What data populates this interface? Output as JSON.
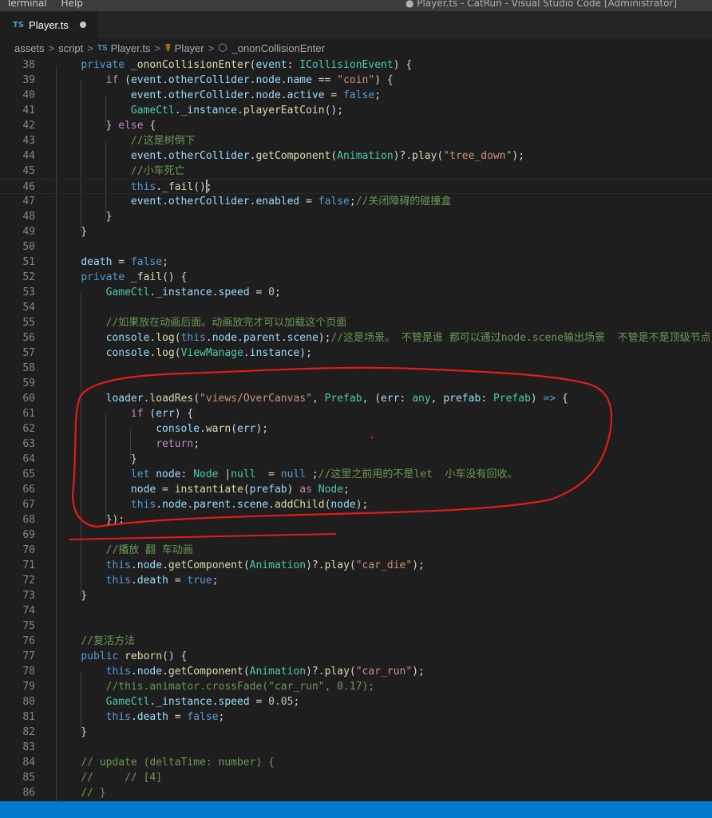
{
  "titlebar": {
    "menu": [
      "Terminal",
      "Help"
    ],
    "window_title": "● Player.ts - CatRun - Visual Studio Code [Administrator]"
  },
  "tab": {
    "badge": "TS",
    "label": "Player.ts"
  },
  "breadcrumb": {
    "items": [
      "assets",
      "script",
      "Player.ts",
      "Player",
      "_ononCollisionEnter"
    ],
    "ts_badge": "TS",
    "class_icon": "class-symbol-icon",
    "method_icon": "method-symbol-icon"
  },
  "colors": {
    "keyword": "#569cd6",
    "control": "#c586c0",
    "function": "#dcdcaa",
    "property": "#9cdcfe",
    "type": "#4ec9b0",
    "string": "#ce9178",
    "number": "#b5cea8",
    "comment": "#6a9955",
    "status_bar": "#007acc",
    "annotation": "#e51b1b"
  },
  "editor": {
    "current_line": 46,
    "lines": [
      {
        "n": "38",
        "t": [
          [
            "    ",
            ""
          ],
          [
            "private",
            "k"
          ],
          [
            " ",
            ""
          ],
          [
            "_ononCollisionEnter",
            "f"
          ],
          [
            "(",
            ""
          ],
          [
            "event",
            "p"
          ],
          [
            ": ",
            ""
          ],
          [
            "ICollisionEvent",
            "t"
          ],
          [
            ") {",
            ""
          ]
        ]
      },
      {
        "n": "39",
        "t": [
          [
            "        ",
            ""
          ],
          [
            "if",
            "c"
          ],
          [
            " (",
            ""
          ],
          [
            "event",
            "p"
          ],
          [
            ".",
            ""
          ],
          [
            "otherCollider",
            "p"
          ],
          [
            ".",
            ""
          ],
          [
            "node",
            "p"
          ],
          [
            ".",
            ""
          ],
          [
            "name",
            "p"
          ],
          [
            " == ",
            ""
          ],
          [
            "\"coin\"",
            "s"
          ],
          [
            ") {",
            ""
          ]
        ]
      },
      {
        "n": "40",
        "t": [
          [
            "            ",
            ""
          ],
          [
            "event",
            "p"
          ],
          [
            ".",
            ""
          ],
          [
            "otherCollider",
            "p"
          ],
          [
            ".",
            ""
          ],
          [
            "node",
            "p"
          ],
          [
            ".",
            ""
          ],
          [
            "active",
            "p"
          ],
          [
            " = ",
            ""
          ],
          [
            "false",
            "k"
          ],
          [
            ";",
            ""
          ]
        ]
      },
      {
        "n": "41",
        "t": [
          [
            "            ",
            ""
          ],
          [
            "GameCtl",
            "t"
          ],
          [
            ".",
            ""
          ],
          [
            "_instance",
            "p"
          ],
          [
            ".",
            ""
          ],
          [
            "playerEatCoin",
            "f"
          ],
          [
            "();",
            ""
          ]
        ]
      },
      {
        "n": "42",
        "t": [
          [
            "        } ",
            ""
          ],
          [
            "else",
            "c"
          ],
          [
            " {",
            ""
          ]
        ]
      },
      {
        "n": "43",
        "t": [
          [
            "            ",
            ""
          ],
          [
            "//这是树倒下",
            "m"
          ]
        ]
      },
      {
        "n": "44",
        "t": [
          [
            "            ",
            ""
          ],
          [
            "event",
            "p"
          ],
          [
            ".",
            ""
          ],
          [
            "otherCollider",
            "p"
          ],
          [
            ".",
            ""
          ],
          [
            "getComponent",
            "f"
          ],
          [
            "(",
            ""
          ],
          [
            "Animation",
            "t"
          ],
          [
            ")?.",
            ""
          ],
          [
            "play",
            "f"
          ],
          [
            "(",
            ""
          ],
          [
            "\"tree_down\"",
            "s"
          ],
          [
            ");",
            ""
          ]
        ]
      },
      {
        "n": "45",
        "t": [
          [
            "            ",
            ""
          ],
          [
            "//小车死亡",
            "m"
          ]
        ]
      },
      {
        "n": "46",
        "t": [
          [
            "            ",
            ""
          ],
          [
            "this",
            "k"
          ],
          [
            ".",
            ""
          ],
          [
            "_fail",
            "f"
          ],
          [
            "();",
            ""
          ]
        ]
      },
      {
        "n": "47",
        "t": [
          [
            "            ",
            ""
          ],
          [
            "event",
            "p"
          ],
          [
            ".",
            ""
          ],
          [
            "otherCollider",
            "p"
          ],
          [
            ".",
            ""
          ],
          [
            "enabled",
            "p"
          ],
          [
            " = ",
            ""
          ],
          [
            "false",
            "k"
          ],
          [
            ";",
            ""
          ],
          [
            "//关闭障碍的碰撞盒",
            "m"
          ]
        ]
      },
      {
        "n": "48",
        "t": [
          [
            "        }",
            ""
          ]
        ]
      },
      {
        "n": "49",
        "t": [
          [
            "    }",
            ""
          ]
        ]
      },
      {
        "n": "50",
        "t": []
      },
      {
        "n": "51",
        "t": [
          [
            "    ",
            ""
          ],
          [
            "death",
            "p"
          ],
          [
            " = ",
            ""
          ],
          [
            "false",
            "k"
          ],
          [
            ";",
            ""
          ]
        ]
      },
      {
        "n": "52",
        "t": [
          [
            "    ",
            ""
          ],
          [
            "private",
            "k"
          ],
          [
            " ",
            ""
          ],
          [
            "_fail",
            "f"
          ],
          [
            "() {",
            ""
          ]
        ]
      },
      {
        "n": "53",
        "t": [
          [
            "        ",
            ""
          ],
          [
            "GameCtl",
            "t"
          ],
          [
            ".",
            ""
          ],
          [
            "_instance",
            "p"
          ],
          [
            ".",
            ""
          ],
          [
            "speed",
            "p"
          ],
          [
            " = ",
            ""
          ],
          [
            "0",
            "n"
          ],
          [
            ";",
            ""
          ]
        ]
      },
      {
        "n": "54",
        "t": []
      },
      {
        "n": "55",
        "t": [
          [
            "        ",
            ""
          ],
          [
            "//如果放在动画后面。动画放完才可以加载这个页面",
            "m"
          ]
        ]
      },
      {
        "n": "56",
        "t": [
          [
            "        ",
            ""
          ],
          [
            "console",
            "p"
          ],
          [
            ".",
            ""
          ],
          [
            "log",
            "f"
          ],
          [
            "(",
            ""
          ],
          [
            "this",
            "k"
          ],
          [
            ".",
            ""
          ],
          [
            "node",
            "p"
          ],
          [
            ".",
            ""
          ],
          [
            "parent",
            "p"
          ],
          [
            ".",
            ""
          ],
          [
            "scene",
            "p"
          ],
          [
            ");",
            ""
          ],
          [
            "//这是场景。 不管是谁 都可以通过node.scene输出场景  不管是不是顶级节点",
            "m"
          ]
        ]
      },
      {
        "n": "57",
        "t": [
          [
            "        ",
            ""
          ],
          [
            "console",
            "p"
          ],
          [
            ".",
            ""
          ],
          [
            "log",
            "f"
          ],
          [
            "(",
            ""
          ],
          [
            "ViewManage",
            "t"
          ],
          [
            ".",
            ""
          ],
          [
            "instance",
            "p"
          ],
          [
            ");",
            ""
          ]
        ]
      },
      {
        "n": "58",
        "t": []
      },
      {
        "n": "59",
        "t": []
      },
      {
        "n": "60",
        "t": [
          [
            "        ",
            ""
          ],
          [
            "loader",
            "p"
          ],
          [
            ".",
            ""
          ],
          [
            "loadRes",
            "f"
          ],
          [
            "(",
            ""
          ],
          [
            "\"views/OverCanvas\"",
            "s"
          ],
          [
            ", ",
            ""
          ],
          [
            "Prefab",
            "t"
          ],
          [
            ", (",
            ""
          ],
          [
            "err",
            "p"
          ],
          [
            ": ",
            ""
          ],
          [
            "any",
            "t"
          ],
          [
            ", ",
            ""
          ],
          [
            "prefab",
            "p"
          ],
          [
            ": ",
            ""
          ],
          [
            "Prefab",
            "t"
          ],
          [
            ") ",
            ""
          ],
          [
            "=>",
            "k"
          ],
          [
            " {",
            ""
          ]
        ]
      },
      {
        "n": "61",
        "t": [
          [
            "            ",
            ""
          ],
          [
            "if",
            "c"
          ],
          [
            " (",
            ""
          ],
          [
            "err",
            "p"
          ],
          [
            ") {",
            ""
          ]
        ]
      },
      {
        "n": "62",
        "t": [
          [
            "                ",
            ""
          ],
          [
            "console",
            "p"
          ],
          [
            ".",
            ""
          ],
          [
            "warn",
            "f"
          ],
          [
            "(",
            ""
          ],
          [
            "err",
            "p"
          ],
          [
            ");",
            ""
          ]
        ]
      },
      {
        "n": "63",
        "t": [
          [
            "                ",
            ""
          ],
          [
            "return",
            "c"
          ],
          [
            ";",
            ""
          ]
        ]
      },
      {
        "n": "64",
        "t": [
          [
            "            }",
            ""
          ]
        ]
      },
      {
        "n": "65",
        "t": [
          [
            "            ",
            ""
          ],
          [
            "let",
            "k"
          ],
          [
            " ",
            ""
          ],
          [
            "node",
            "p"
          ],
          [
            ": ",
            ""
          ],
          [
            "Node",
            "t"
          ],
          [
            " |",
            ""
          ],
          [
            "null",
            "t"
          ],
          [
            "  = ",
            ""
          ],
          [
            "null",
            "k"
          ],
          [
            " ;",
            ""
          ],
          [
            "//这里之前用的不是let  小车没有回收。",
            "m"
          ]
        ]
      },
      {
        "n": "66",
        "t": [
          [
            "            ",
            ""
          ],
          [
            "node",
            "p"
          ],
          [
            " = ",
            ""
          ],
          [
            "instantiate",
            "f"
          ],
          [
            "(",
            ""
          ],
          [
            "prefab",
            "p"
          ],
          [
            ") ",
            ""
          ],
          [
            "as",
            "c"
          ],
          [
            " ",
            ""
          ],
          [
            "Node",
            "t"
          ],
          [
            ";",
            ""
          ]
        ]
      },
      {
        "n": "67",
        "t": [
          [
            "            ",
            ""
          ],
          [
            "this",
            "k"
          ],
          [
            ".",
            ""
          ],
          [
            "node",
            "p"
          ],
          [
            ".",
            ""
          ],
          [
            "parent",
            "p"
          ],
          [
            ".",
            ""
          ],
          [
            "scene",
            "p"
          ],
          [
            ".",
            ""
          ],
          [
            "addChild",
            "f"
          ],
          [
            "(",
            ""
          ],
          [
            "node",
            "p"
          ],
          [
            ");",
            ""
          ]
        ]
      },
      {
        "n": "68",
        "t": [
          [
            "        });",
            ""
          ]
        ]
      },
      {
        "n": "69",
        "t": []
      },
      {
        "n": "70",
        "t": [
          [
            "        ",
            ""
          ],
          [
            "//播放 翻 车动画",
            "m"
          ]
        ]
      },
      {
        "n": "71",
        "t": [
          [
            "        ",
            ""
          ],
          [
            "this",
            "k"
          ],
          [
            ".",
            ""
          ],
          [
            "node",
            "p"
          ],
          [
            ".",
            ""
          ],
          [
            "getComponent",
            "f"
          ],
          [
            "(",
            ""
          ],
          [
            "Animation",
            "t"
          ],
          [
            ")?.",
            ""
          ],
          [
            "play",
            "f"
          ],
          [
            "(",
            ""
          ],
          [
            "\"car_die\"",
            "s"
          ],
          [
            ");",
            ""
          ]
        ]
      },
      {
        "n": "72",
        "t": [
          [
            "        ",
            ""
          ],
          [
            "this",
            "k"
          ],
          [
            ".",
            ""
          ],
          [
            "death",
            "p"
          ],
          [
            " = ",
            ""
          ],
          [
            "true",
            "k"
          ],
          [
            ";",
            ""
          ]
        ]
      },
      {
        "n": "73",
        "t": [
          [
            "    }",
            ""
          ]
        ]
      },
      {
        "n": "74",
        "t": []
      },
      {
        "n": "75",
        "t": []
      },
      {
        "n": "76",
        "t": [
          [
            "    ",
            ""
          ],
          [
            "//复活方法",
            "m"
          ]
        ]
      },
      {
        "n": "77",
        "t": [
          [
            "    ",
            ""
          ],
          [
            "public",
            "k"
          ],
          [
            " ",
            ""
          ],
          [
            "reborn",
            "f"
          ],
          [
            "() {",
            ""
          ]
        ]
      },
      {
        "n": "78",
        "t": [
          [
            "        ",
            ""
          ],
          [
            "this",
            "k"
          ],
          [
            ".",
            ""
          ],
          [
            "node",
            "p"
          ],
          [
            ".",
            ""
          ],
          [
            "getComponent",
            "f"
          ],
          [
            "(",
            ""
          ],
          [
            "Animation",
            "t"
          ],
          [
            ")?.",
            ""
          ],
          [
            "play",
            "f"
          ],
          [
            "(",
            ""
          ],
          [
            "\"car_run\"",
            "s"
          ],
          [
            ");",
            ""
          ]
        ]
      },
      {
        "n": "79",
        "t": [
          [
            "        ",
            ""
          ],
          [
            "//this.animator.crossFade(\"car_run\", 0.17);",
            "m"
          ]
        ]
      },
      {
        "n": "80",
        "t": [
          [
            "        ",
            ""
          ],
          [
            "GameCtl",
            "t"
          ],
          [
            ".",
            ""
          ],
          [
            "_instance",
            "p"
          ],
          [
            ".",
            ""
          ],
          [
            "speed",
            "p"
          ],
          [
            " = ",
            ""
          ],
          [
            "0.05",
            "n"
          ],
          [
            ";",
            ""
          ]
        ]
      },
      {
        "n": "81",
        "t": [
          [
            "        ",
            ""
          ],
          [
            "this",
            "k"
          ],
          [
            ".",
            ""
          ],
          [
            "death",
            "p"
          ],
          [
            " = ",
            ""
          ],
          [
            "false",
            "k"
          ],
          [
            ";",
            ""
          ]
        ]
      },
      {
        "n": "82",
        "t": [
          [
            "    }",
            ""
          ]
        ]
      },
      {
        "n": "83",
        "t": []
      },
      {
        "n": "84",
        "t": [
          [
            "    ",
            ""
          ],
          [
            "// update (deltaTime: number) {",
            "m"
          ]
        ]
      },
      {
        "n": "85",
        "t": [
          [
            "    ",
            ""
          ],
          [
            "//     // [4]",
            "m"
          ]
        ]
      },
      {
        "n": "86",
        "t": [
          [
            "    ",
            ""
          ],
          [
            "// }",
            "m"
          ]
        ]
      }
    ]
  }
}
